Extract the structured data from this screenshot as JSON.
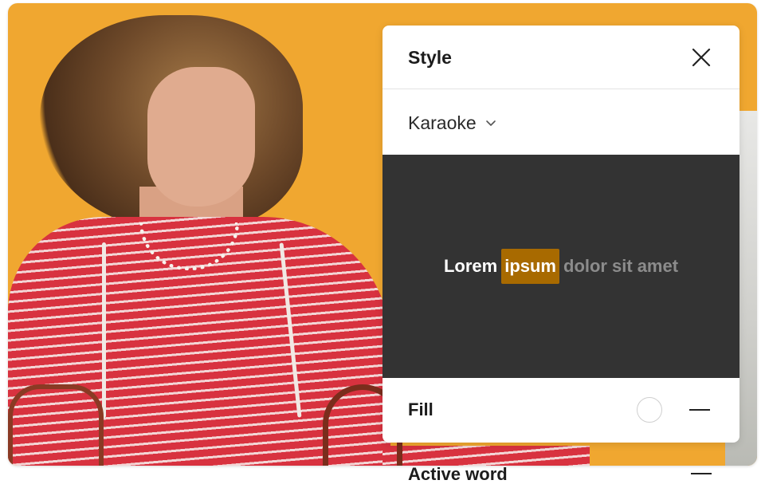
{
  "panel": {
    "title": "Style",
    "close_icon": "close-icon",
    "style_select": {
      "value": "Karaoke",
      "icon": "chevron-down-icon"
    },
    "preview": {
      "words": [
        {
          "text": "Lorem",
          "state": "done"
        },
        {
          "text": "ipsum",
          "state": "active"
        },
        {
          "text": "dolor",
          "state": "upcoming"
        },
        {
          "text": "sit",
          "state": "upcoming"
        },
        {
          "text": "amet",
          "state": "upcoming"
        }
      ],
      "background_color": "#333333",
      "highlight_color": "#a86a00"
    },
    "fill": {
      "label": "Fill",
      "swatch_color": "#ffffff",
      "remove_icon": "minus-icon"
    },
    "active_word": {
      "label": "Active word",
      "remove_icon": "minus-icon"
    }
  },
  "background": {
    "accent_color": "#f0a730"
  }
}
